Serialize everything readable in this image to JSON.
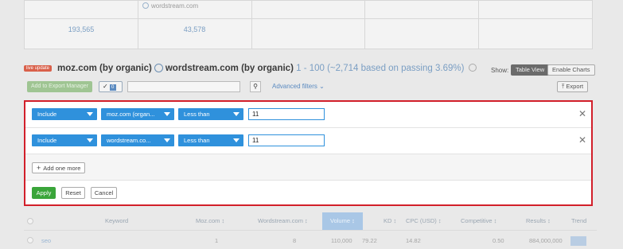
{
  "summary": {
    "domain_label": "wordstream.com",
    "values": [
      "193,565",
      "43,578"
    ]
  },
  "header": {
    "badge": "live update",
    "domain1": "moz.com (by organic)",
    "domain2": "wordstream.com (by organic)",
    "range": "1 - 100 (~2,714 based on passing 3.69%)",
    "show_label": "Show:",
    "table_view": "Table View",
    "enable_charts": "Enable Charts"
  },
  "toolbar": {
    "add_export": "Add to Export Manager",
    "check_count": "0",
    "filter_value": "",
    "advanced_filters": "Advanced filters",
    "export": "Export"
  },
  "filters": [
    {
      "include": "Include",
      "domain": "moz.com (organ...",
      "condition": "Less than",
      "value": "11"
    },
    {
      "include": "Include",
      "domain": "wordstream.co...",
      "condition": "Less than",
      "value": "11"
    }
  ],
  "actions": {
    "add_one_more": "Add one more",
    "apply": "Apply",
    "reset": "Reset",
    "cancel": "Cancel"
  },
  "table": {
    "headers": [
      "Keyword",
      "Moz.com ↕",
      "Wordstream.com ↕",
      "Volume ↕",
      "KD ↕",
      "CPC (USD) ↕",
      "Competitive ↕",
      "Results ↕",
      "Trend"
    ],
    "row": [
      "seo",
      "1",
      "8",
      "110,000",
      "79.22",
      "14.82",
      "0.50",
      "884,000,000"
    ]
  },
  "colors": {
    "accent_blue": "#2f91dc",
    "apply_green": "#3aa53a",
    "highlight_red": "#d21f2a"
  }
}
